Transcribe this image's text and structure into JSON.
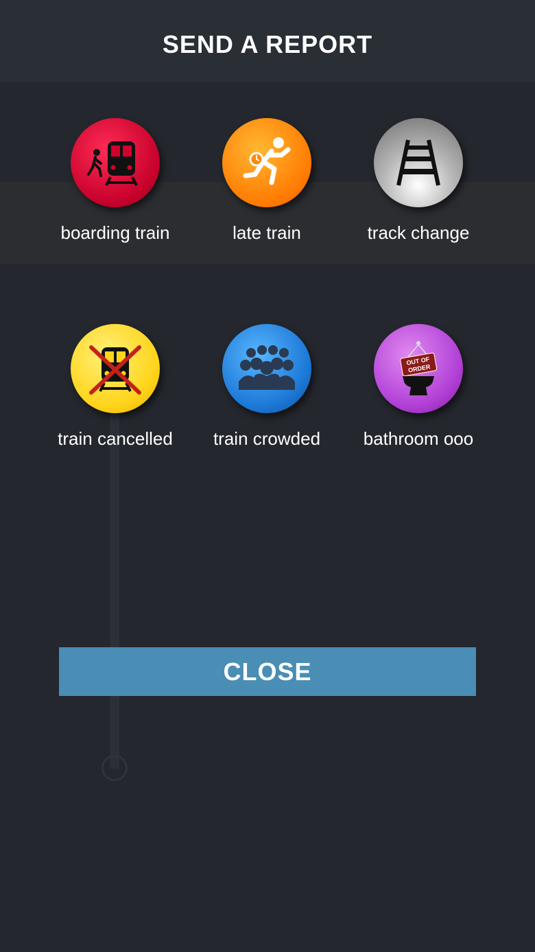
{
  "modal": {
    "title": "SEND A REPORT",
    "close_label": "CLOSE"
  },
  "reports": [
    {
      "label": "boarding train",
      "icon": "boarding-train-icon",
      "color": "#d1002d"
    },
    {
      "label": "late train",
      "icon": "late-train-icon",
      "color": "#ff8a00"
    },
    {
      "label": "track change",
      "icon": "track-change-icon",
      "color": "#a0a0a0"
    },
    {
      "label": "train cancelled",
      "icon": "train-cancelled-icon",
      "color": "#ffd41a"
    },
    {
      "label": "train crowded",
      "icon": "train-crowded-icon",
      "color": "#1c78d6"
    },
    {
      "label": "bathroom ooo",
      "icon": "bathroom-out-of-order-icon",
      "color": "#b13fd6",
      "sign_text": [
        "OUT OF",
        "ORDER"
      ]
    }
  ],
  "colors": {
    "background": "#24272d",
    "close_button": "#4a8db5"
  }
}
